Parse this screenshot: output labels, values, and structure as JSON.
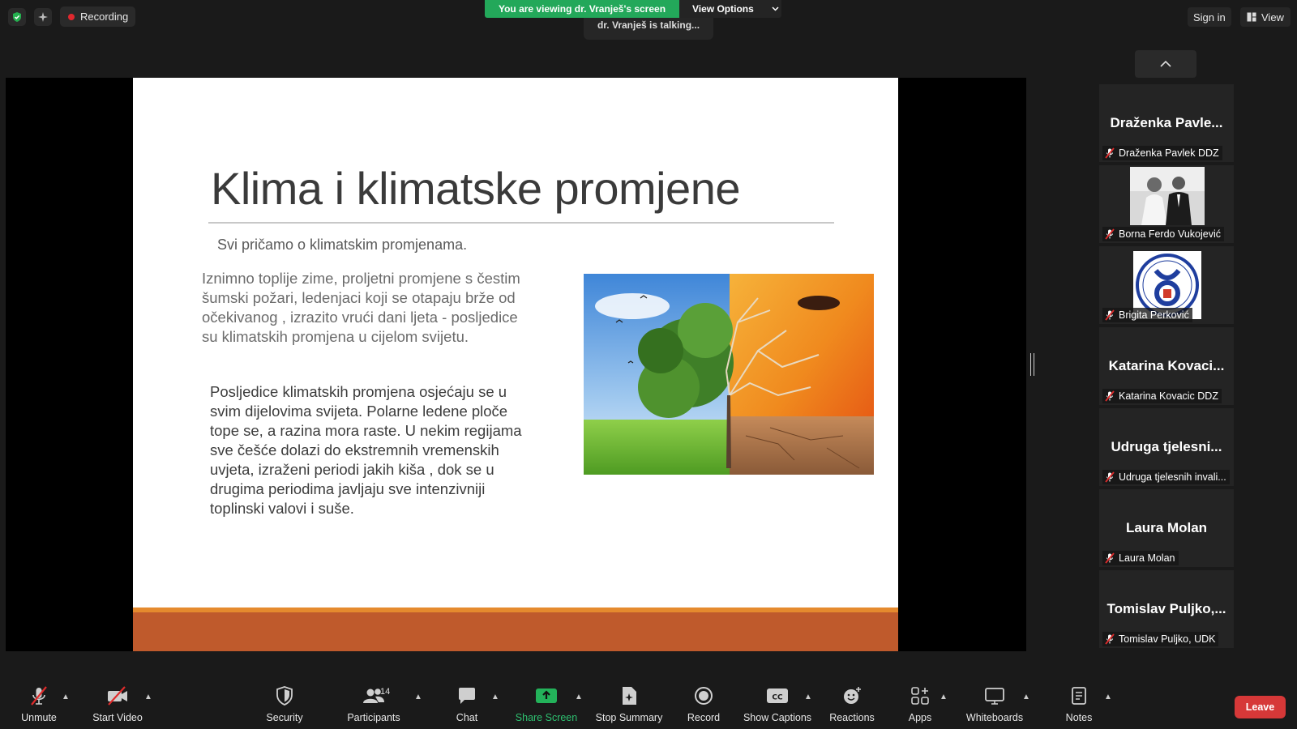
{
  "top": {
    "recording_label": "Recording",
    "viewing_banner": "You are viewing dr. Vranješ's screen",
    "view_options_label": "View Options",
    "talking_label": "dr. Vranješ is talking...",
    "sign_in_label": "Sign in",
    "view_label": "View"
  },
  "slide": {
    "title": "Klima  i klimatske promjene",
    "subtitle": "Svi pričamo o klimatskim promjenama.",
    "paragraph1": "Iznimno toplije zime,  proljetni  promjene s čestim šumski požari, ledenjaci koji se otapaju brže od očekivanog , izrazito vrući dani ljeta - posljedice su klimatskih promjena u cijelom svijetu.",
    "paragraph2": "Posljedice klimatskih promjena osjećaju se u svim dijelovima svijeta. Polarne ledene ploče tope se, a razina mora raste. U nekim regijama sve češće dolazi do ekstremnih vremenskih uvjeta, izraženi periodi jakih  kiša , dok se u drugima periodima javljaju sve intenzivniji toplinski valovi i suše."
  },
  "participants": [
    {
      "display": "Draženka  Pavle...",
      "name": "Draženka Pavlek DDZ",
      "type": "name"
    },
    {
      "display": "",
      "name": "Borna Ferdo Vukojević",
      "type": "photo"
    },
    {
      "display": "",
      "name": "Brigita Perković",
      "type": "logo"
    },
    {
      "display": "Katarina  Kovaci...",
      "name": "Katarina Kovacic DDZ",
      "type": "name"
    },
    {
      "display": "Udruga  tjelesni...",
      "name": "Udruga tjelesnih invali...",
      "type": "name"
    },
    {
      "display": "Laura Molan",
      "name": "Laura Molan",
      "type": "name"
    },
    {
      "display": "Tomislav  Puljko,...",
      "name": "Tomislav Puljko, UDK",
      "type": "name"
    }
  ],
  "toolbar": {
    "unmute": "Unmute",
    "start_video": "Start Video",
    "security": "Security",
    "participants": "Participants",
    "participants_count": "14",
    "chat": "Chat",
    "share_screen": "Share Screen",
    "stop_summary": "Stop Summary",
    "record": "Record",
    "show_captions": "Show Captions",
    "reactions": "Reactions",
    "apps": "Apps",
    "whiteboards": "Whiteboards",
    "notes": "Notes",
    "leave": "Leave"
  },
  "colors": {
    "share_green": "#23a85a",
    "leave_red": "#d63838",
    "slide_band": "#bf5a2c",
    "slide_band_top": "#e58a2e"
  }
}
